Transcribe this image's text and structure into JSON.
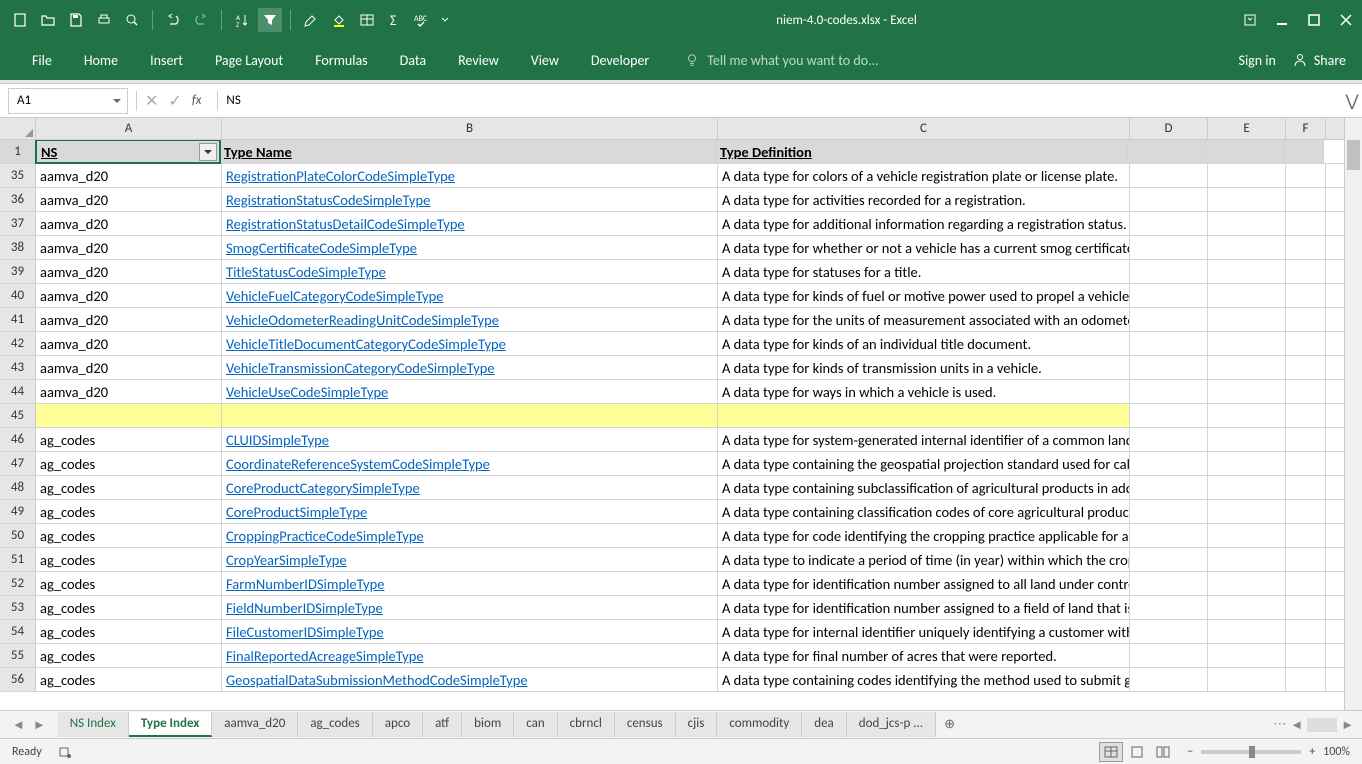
{
  "titlebar": {
    "title": "niem-4.0-codes.xlsx - Excel"
  },
  "ribbon": {
    "tabs": [
      "File",
      "Home",
      "Insert",
      "Page Layout",
      "Formulas",
      "Data",
      "Review",
      "View",
      "Developer"
    ],
    "tell_me": "Tell me what you want to do...",
    "sign_in": "Sign in",
    "share": "Share"
  },
  "name_box": "A1",
  "formula": "NS",
  "columns": [
    "A",
    "B",
    "C",
    "D",
    "E",
    "F"
  ],
  "headers": {
    "ns": "NS",
    "type_name": "Type Name",
    "type_def": "Type Definition"
  },
  "rows": [
    {
      "n": 35,
      "ns": "aamva_d20",
      "tn": "RegistrationPlateColorCodeSimpleType",
      "td": "A data type for colors of a vehicle registration plate or license plate."
    },
    {
      "n": 36,
      "ns": "aamva_d20",
      "tn": "RegistrationStatusCodeSimpleType",
      "td": "A data type for activities recorded for a registration."
    },
    {
      "n": 37,
      "ns": "aamva_d20",
      "tn": "RegistrationStatusDetailCodeSimpleType",
      "td": "A data type for additional information regarding a registration status."
    },
    {
      "n": 38,
      "ns": "aamva_d20",
      "tn": "SmogCertificateCodeSimpleType",
      "td": "A data type for whether or not a vehicle has a current smog certificate."
    },
    {
      "n": 39,
      "ns": "aamva_d20",
      "tn": "TitleStatusCodeSimpleType",
      "td": "A data type for statuses for a title."
    },
    {
      "n": 40,
      "ns": "aamva_d20",
      "tn": "VehicleFuelCategoryCodeSimpleType",
      "td": "A data type for kinds of fuel or motive power used to propel a vehicle."
    },
    {
      "n": 41,
      "ns": "aamva_d20",
      "tn": "VehicleOdometerReadingUnitCodeSimpleType",
      "td": "A data type for the units of measurement associated with an odometer reading."
    },
    {
      "n": 42,
      "ns": "aamva_d20",
      "tn": "VehicleTitleDocumentCategoryCodeSimpleType",
      "td": "A data type for kinds of an individual title document."
    },
    {
      "n": 43,
      "ns": "aamva_d20",
      "tn": "VehicleTransmissionCategoryCodeSimpleType",
      "td": "A data type for kinds of transmission units in a vehicle."
    },
    {
      "n": 44,
      "ns": "aamva_d20",
      "tn": "VehicleUseCodeSimpleType",
      "td": "A data type for ways in which a vehicle is used."
    },
    {
      "n": 45,
      "ns": "",
      "tn": "",
      "td": "",
      "yellow": true
    },
    {
      "n": 46,
      "ns": "ag_codes",
      "tn": "CLUIDSimpleType",
      "td": "A data type for system-generated internal identifier of a common land unit (CLU). Th"
    },
    {
      "n": 47,
      "ns": "ag_codes",
      "tn": "CoordinateReferenceSystemCodeSimpleType",
      "td": "A data type containing the geospatial projection standard used for calculating acreag"
    },
    {
      "n": 48,
      "ns": "ag_codes",
      "tn": "CoreProductCategorySimpleType",
      "td": "A data type containing subclassification of agricultural products in addition to the ma"
    },
    {
      "n": 49,
      "ns": "ag_codes",
      "tn": "CoreProductSimpleType",
      "td": "A data type containing classification codes of core agricultural products defined by th"
    },
    {
      "n": 50,
      "ns": "ag_codes",
      "tn": "CroppingPracticeCodeSimpleType",
      "td": "A data type for code identifying the cropping practice applicable for a reported crop/"
    },
    {
      "n": 51,
      "ns": "ag_codes",
      "tn": "CropYearSimpleType",
      "td": "A data type to indicate a period of time (in year) within which the crop is normally gro"
    },
    {
      "n": 52,
      "ns": "ag_codes",
      "tn": "FarmNumberIDSimpleType",
      "td": "A data type for identification number assigned to all land under control of a particula"
    },
    {
      "n": 53,
      "ns": "ag_codes",
      "tn": "FieldNumberIDSimpleType",
      "td": "A data type for identification number assigned to a field of land that is part of a farm"
    },
    {
      "n": 54,
      "ns": "ag_codes",
      "tn": "FileCustomerIDSimpleType",
      "td": "A data type for internal identifier uniquely identifying a customer within a specific file"
    },
    {
      "n": 55,
      "ns": "ag_codes",
      "tn": "FinalReportedAcreageSimpleType",
      "td": "A data type for final number of acres that were reported."
    },
    {
      "n": 56,
      "ns": "ag_codes",
      "tn": "GeospatialDataSubmissionMethodCodeSimpleType",
      "td": "A data type containing codes identifying the method used to submit geospatial data u"
    }
  ],
  "sheet_tabs": [
    "NS Index",
    "Type Index",
    "aamva_d20",
    "ag_codes",
    "apco",
    "atf",
    "biom",
    "can",
    "cbrncl",
    "census",
    "cjis",
    "commodity",
    "dea",
    "dod_jcs-p ..."
  ],
  "active_sheet": "Type Index",
  "status": {
    "ready": "Ready",
    "zoom": "100%"
  }
}
